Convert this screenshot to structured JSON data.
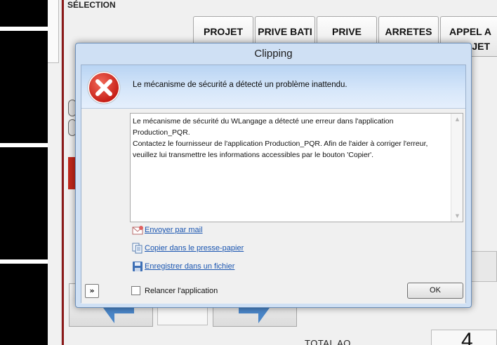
{
  "background": {
    "section_title": "SÉLECTION",
    "tabs": [
      "PROJET\nPUBLIC",
      "PRIVE BATI",
      "PRIVE\nHORS BATI",
      "ARRETES",
      "APPEL A\nPROJET"
    ],
    "total_label": "TOTAL AO",
    "total_value": "4"
  },
  "dialog": {
    "title": "Clipping",
    "icon": "error-x-icon",
    "heading": "Le mécanisme de sécurité a détecté un problème inattendu.",
    "message_lines": [
      "Le mécanisme de sécurité du WLangage a détecté une erreur dans l'application",
      "Production_PQR.",
      "Contactez le fournisseur de l'application Production_PQR. Afin de l'aider à corriger l'erreur,",
      "veuillez lui transmettre les informations accessibles par le bouton 'Copier'."
    ],
    "actions": {
      "mail": "Envoyer par mail",
      "copy": "Copier dans le presse-papier",
      "save": "Enregistrer dans un fichier"
    },
    "expand_label": "»",
    "relaunch_label": "Relancer l'application",
    "relaunch_checked": false,
    "ok_label": "OK"
  },
  "colors": {
    "link": "#1a55b0",
    "error_red": "#d8231f",
    "header_gradient_top": "#b9d4f3"
  }
}
